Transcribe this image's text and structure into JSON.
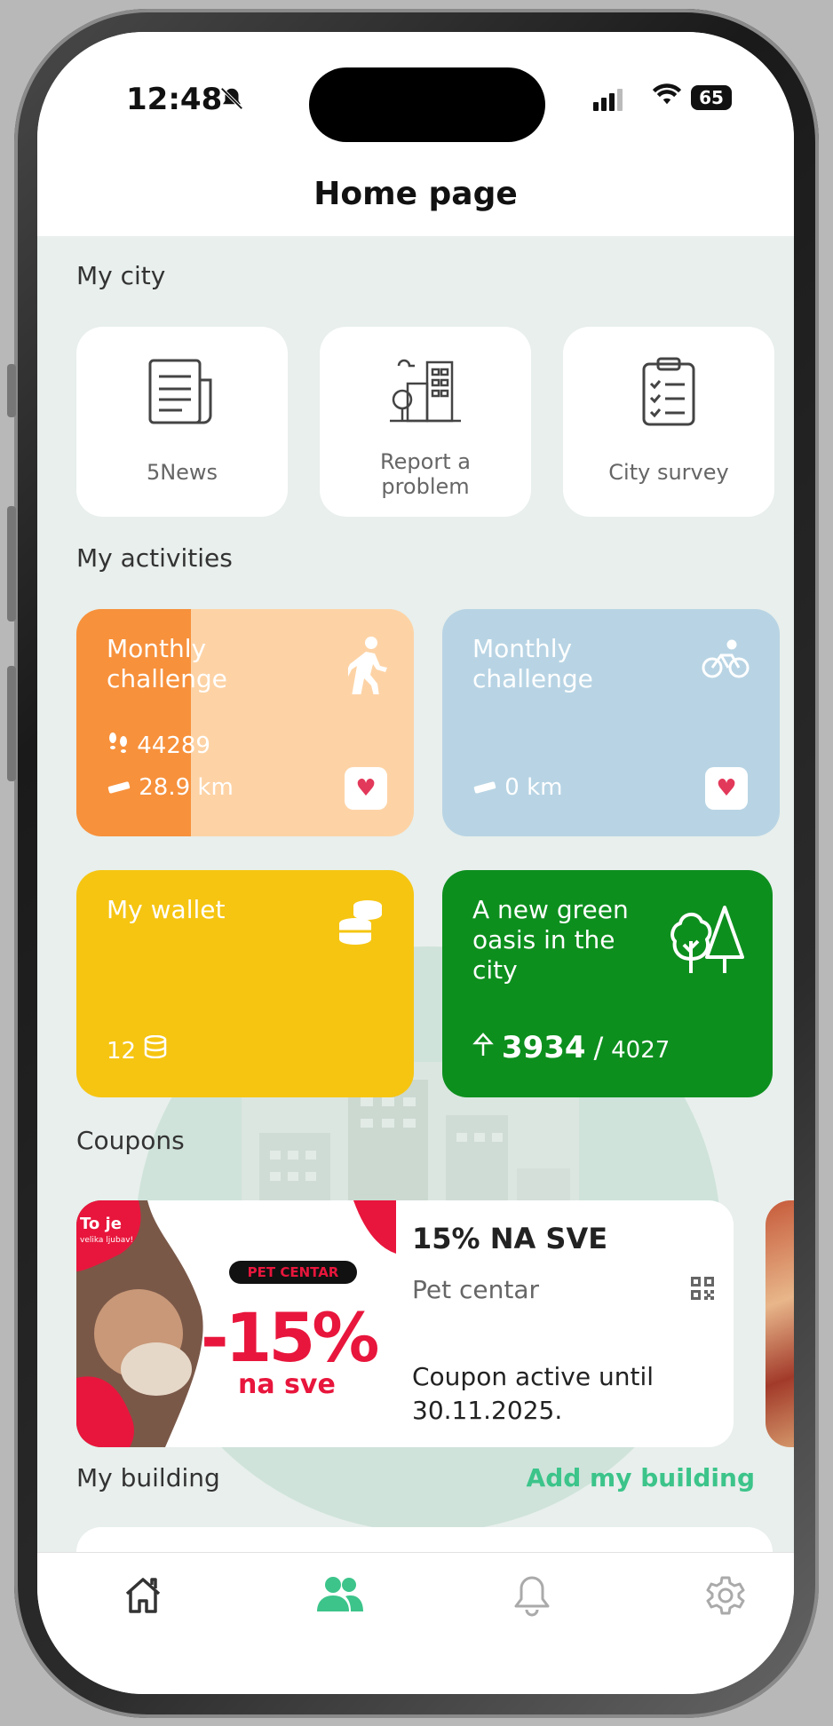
{
  "status_bar": {
    "time": "12:48",
    "battery": "65"
  },
  "header": {
    "title": "Home page"
  },
  "my_city": {
    "section_title": "My city",
    "tiles": [
      {
        "label": "5News",
        "icon": "newspaper-icon"
      },
      {
        "label_line1": "Report a",
        "label_line2": "problem",
        "icon": "city-report-icon"
      },
      {
        "label": "City survey",
        "icon": "clipboard-checklist-icon"
      }
    ]
  },
  "my_activities": {
    "section_title": "My activities",
    "walking_challenge": {
      "title_line1": "Monthly",
      "title_line2": "challenge",
      "steps": "44289",
      "distance": "28.9 km",
      "progress_fraction": 0.34,
      "colors": {
        "fill": "#f7913c",
        "track": "#fdd3a6"
      }
    },
    "cycling_challenge": {
      "title_line1": "Monthly",
      "title_line2": "challenge",
      "distance": "0 km",
      "colors": {
        "bg": "#b8d4e4"
      }
    },
    "wallet": {
      "title": "My wallet",
      "amount": "12",
      "color": "#f6c512"
    },
    "green_oasis": {
      "title_line1": "A new green",
      "title_line2": "oasis in the",
      "title_line3": "city",
      "current": "3934",
      "separator": "/",
      "target": "4027",
      "color": "#0d8f1e"
    }
  },
  "coupons": {
    "section_title": "Coupons",
    "items": [
      {
        "title": "15% NA SVE",
        "vendor": "Pet centar",
        "valid_line1": "Coupon active until",
        "valid_line2": "30.11.2025.",
        "image_text": {
          "tagline": "To je",
          "tagline_small": "velika ljubav!",
          "brand": "PET CENTAR",
          "discount": "-15%",
          "discount_sub": "na sve"
        }
      }
    ]
  },
  "my_building": {
    "section_title": "My building",
    "add_link": "Add my building"
  },
  "nav": [
    {
      "name": "home",
      "icon": "home-icon"
    },
    {
      "name": "community",
      "icon": "people-icon",
      "active": true
    },
    {
      "name": "notifications",
      "icon": "bell-icon"
    },
    {
      "name": "settings",
      "icon": "gear-icon"
    }
  ],
  "colors": {
    "accent_green": "#3cc48a"
  }
}
